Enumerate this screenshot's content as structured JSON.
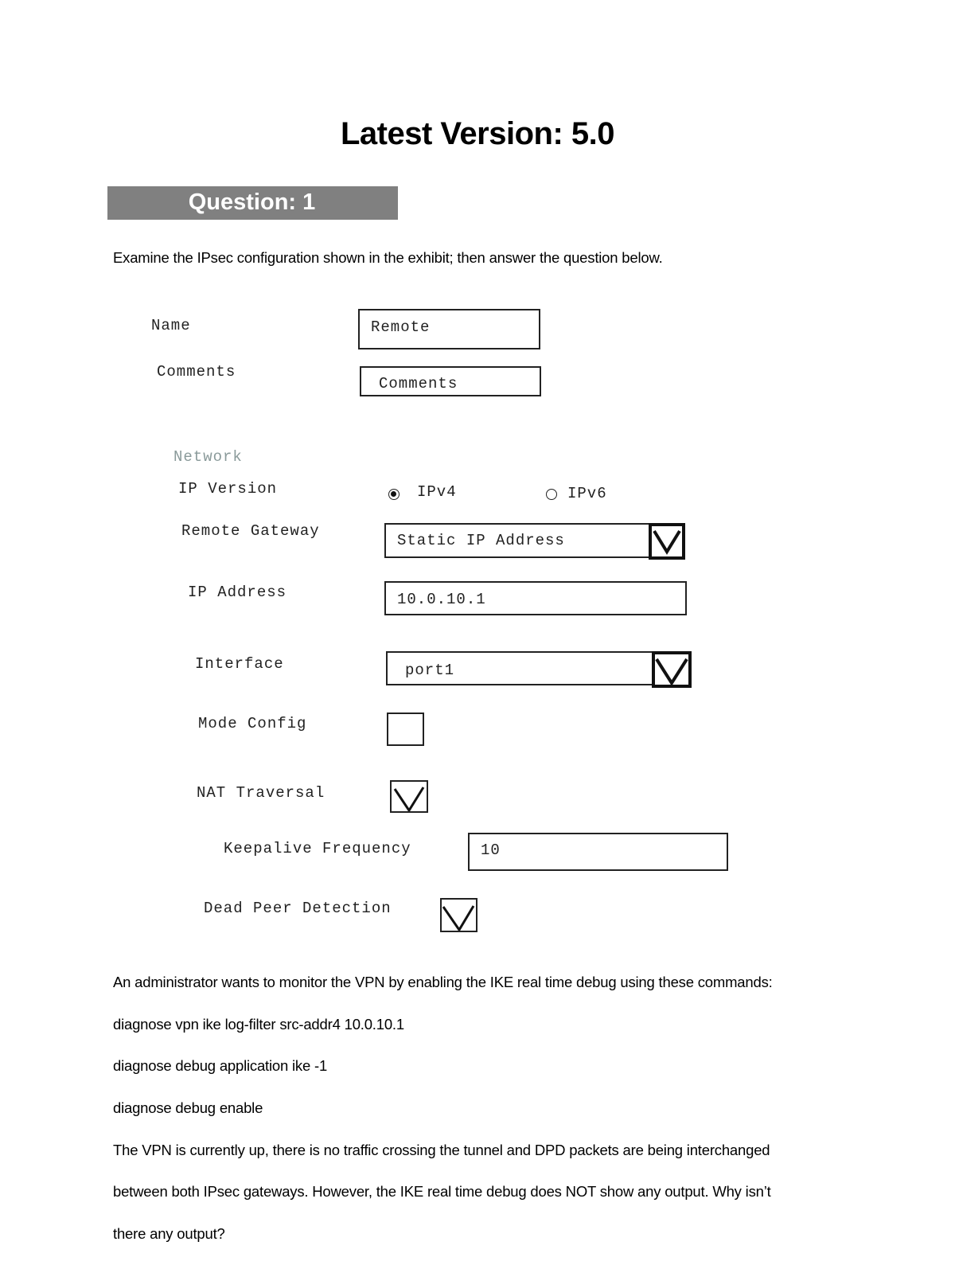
{
  "header": {
    "title": "Latest Version: 5.0",
    "question_label": "Question: 1"
  },
  "intro": "Examine the IPsec configuration shown in the exhibit; then answer the question below.",
  "exhibit": {
    "name": {
      "label": "Name",
      "value": "Remote"
    },
    "comments": {
      "label": "Comments",
      "placeholder": "Comments"
    },
    "network_section": "Network",
    "ip_version": {
      "label": "IP Version",
      "options": [
        {
          "label": "IPv4",
          "selected": true
        },
        {
          "label": "IPv6",
          "selected": false
        }
      ]
    },
    "remote_gateway": {
      "label": "Remote Gateway",
      "value": "Static IP Address"
    },
    "ip_address": {
      "label": "IP Address",
      "value": "10.0.10.1"
    },
    "interface": {
      "label": "Interface",
      "value": "port1"
    },
    "mode_config": {
      "label": "Mode Config",
      "checked": false
    },
    "nat_traversal": {
      "label": "NAT Traversal",
      "checked": true
    },
    "keepalive": {
      "label": "Keepalive Frequency",
      "value": "10"
    },
    "dpd": {
      "label": "Dead Peer Detection",
      "checked": true
    }
  },
  "question": {
    "lines": [
      "An administrator wants to monitor the VPN by enabling the IKE real time debug using these commands:",
      "diagnose vpn ike log-filter src-addr4 10.0.10.1",
      "diagnose debug application ike -1",
      "diagnose debug enable",
      "The VPN is currently up, there is no traffic crossing the tunnel and DPD packets are being interchanged",
      "between both IPsec gateways. However, the IKE real time debug does NOT show any output. Why isn’t",
      "there any output?"
    ]
  }
}
